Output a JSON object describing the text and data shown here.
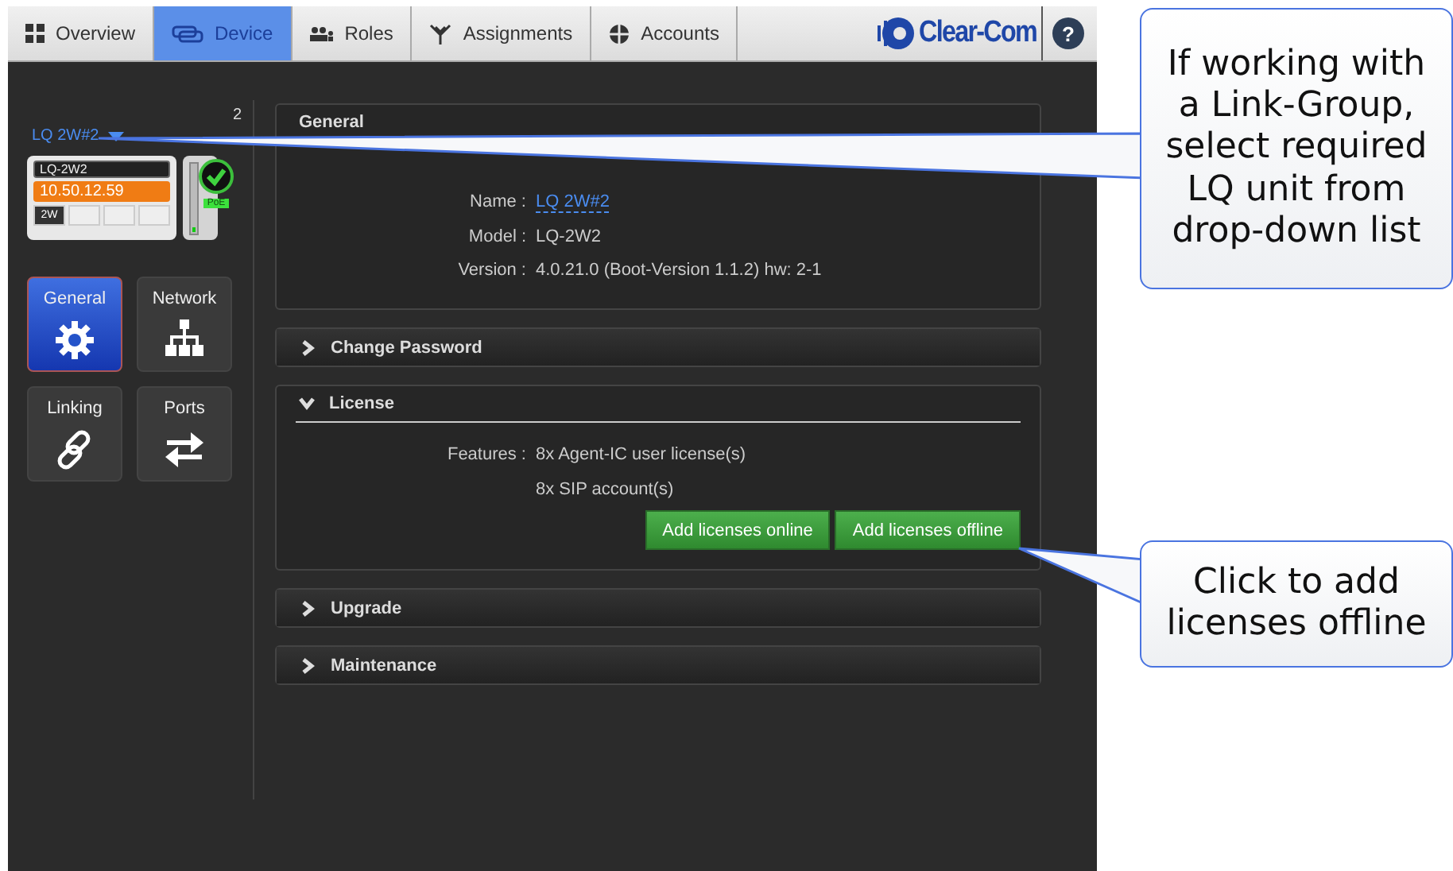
{
  "tabs": [
    {
      "label": "Overview",
      "selected": false
    },
    {
      "label": "Device",
      "selected": true
    },
    {
      "label": "Roles",
      "selected": false
    },
    {
      "label": "Assignments",
      "selected": false
    },
    {
      "label": "Accounts",
      "selected": false
    }
  ],
  "logo": "Clear-Com",
  "help": "?",
  "device": {
    "selector": "LQ 2W#2",
    "count": "2",
    "name": "LQ-2W2",
    "ip": "10.50.12.59",
    "port": "2W",
    "poe": "PoE",
    "online": true
  },
  "nav": [
    {
      "label": "General",
      "selected": true
    },
    {
      "label": "Network",
      "selected": false
    },
    {
      "label": "Linking",
      "selected": false
    },
    {
      "label": "Ports",
      "selected": false
    }
  ],
  "sections": [
    {
      "title": "General",
      "expanded": true,
      "kind": "info",
      "fields": [
        {
          "label": "Name :",
          "value": "LQ 2W#2",
          "kind": "link"
        },
        {
          "label": "Model :",
          "value": "LQ-2W2",
          "kind": "text"
        },
        {
          "label": "Version :",
          "value": "4.0.21.0 (Boot-Version 1.1.2) hw: 2-1",
          "kind": "text"
        }
      ]
    },
    {
      "title": "Change Password",
      "expanded": false
    },
    {
      "title": "License",
      "expanded": true,
      "kind": "license",
      "fields": [
        {
          "label": "Features :",
          "value": "8x Agent-IC user license(s)",
          "kind": "text"
        },
        {
          "value": "8x SIP account(s)",
          "kind": "text"
        }
      ],
      "buttons": [
        "Add licenses online",
        "Add licenses offline"
      ]
    },
    {
      "title": "Upgrade",
      "expanded": false
    },
    {
      "title": "Maintenance",
      "expanded": false
    }
  ],
  "callouts": [
    {
      "text": "If working with a Link-Group, select required LQ unit from drop-down list"
    },
    {
      "text": "Click to add licenses offline"
    }
  ]
}
